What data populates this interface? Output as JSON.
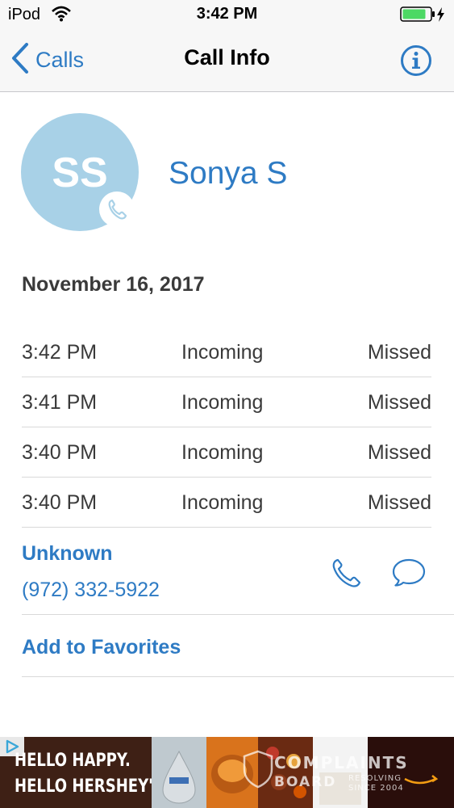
{
  "status_bar": {
    "device": "iPod",
    "time": "3:42 PM"
  },
  "nav": {
    "back_label": "Calls",
    "title": "Call Info"
  },
  "contact": {
    "initials": "SS",
    "name": "Sonya S"
  },
  "date": "November 16, 2017",
  "calls": [
    {
      "time": "3:42 PM",
      "direction": "Incoming",
      "status": "Missed"
    },
    {
      "time": "3:41 PM",
      "direction": "Incoming",
      "status": "Missed"
    },
    {
      "time": "3:40 PM",
      "direction": "Incoming",
      "status": "Missed"
    },
    {
      "time": "3:40 PM",
      "direction": "Incoming",
      "status": "Missed"
    }
  ],
  "number": {
    "label": "Unknown",
    "value": "(972) 332-5922"
  },
  "favorites_label": "Add to Favorites",
  "ad": {
    "headline_line1": "HELLO HAPPY.",
    "headline_line2": "HELLO HERSHEY'S",
    "watermark": "COMPLAINTS",
    "watermark_line2": "BOARD",
    "watermark_tag1": "RESOLVING",
    "watermark_tag2": "SINCE 2004"
  },
  "colors": {
    "accent": "#2e7bc4",
    "avatar": "#a8d1e7",
    "battery": "#4cd964"
  },
  "icons": {
    "back": "chevron-left-icon",
    "info": "info-icon",
    "phone": "phone-icon",
    "message": "message-icon",
    "wifi": "wifi-icon",
    "battery": "battery-icon",
    "charging": "bolt-icon"
  }
}
